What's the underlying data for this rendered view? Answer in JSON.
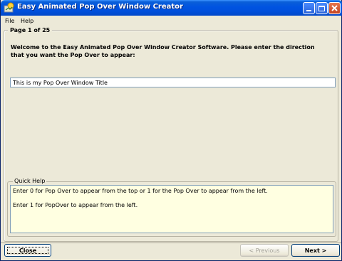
{
  "window": {
    "title": "Easy Animated Pop Over Window Creator"
  },
  "menu": {
    "file_label": "File",
    "help_label": "Help"
  },
  "page": {
    "legend": "Page 1 of 25",
    "welcome": "Welcome to the Easy Animated Pop Over Window Creator Software. Please enter the direction that you want the Pop Over to appear:",
    "input_value": "This is my Pop Over Window Title"
  },
  "quick_help": {
    "legend": "Quick Help",
    "lines": [
      "Enter 0 for Pop Over to appear from the top or 1 for the Pop Over to appear from the left.",
      "Enter 1 for PopOver to appear from the left."
    ]
  },
  "buttons": {
    "close": "Close",
    "previous": "< Previous",
    "next": "Next >"
  },
  "colors": {
    "titlebar": "#0053e1",
    "help_background": "#ffffe1",
    "window_background": "#ece9d8"
  }
}
